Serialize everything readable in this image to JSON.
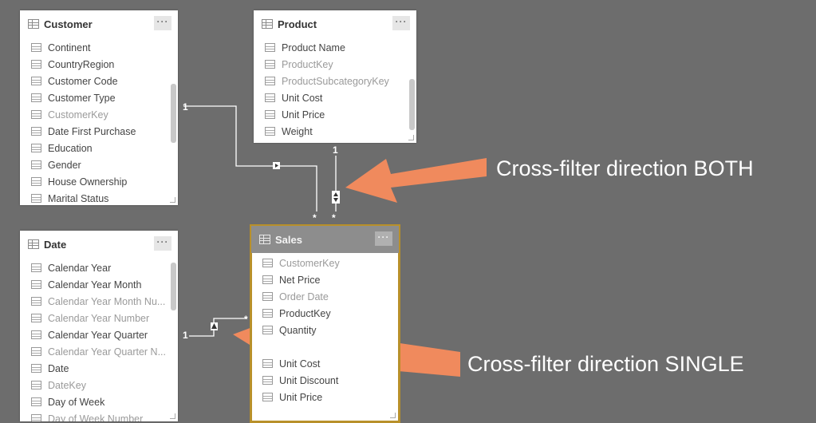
{
  "tables": {
    "customer": {
      "title": "Customer",
      "more": "···",
      "fields": [
        "Continent",
        "CountryRegion",
        "Customer Code",
        "Customer Type",
        "CustomerKey",
        "Date First Purchase",
        "Education",
        "Gender",
        "House Ownership",
        "Marital Status"
      ]
    },
    "product": {
      "title": "Product",
      "more": "···",
      "fields": [
        "Product Name",
        "ProductKey",
        "ProductSubcategoryKey",
        "Unit Cost",
        "Unit Price",
        "Weight"
      ]
    },
    "date": {
      "title": "Date",
      "more": "···",
      "fields": [
        "Calendar Year",
        "Calendar Year Month",
        "Calendar Year Month Nu...",
        "Calendar Year Number",
        "Calendar Year Quarter",
        "Calendar Year Quarter N...",
        "Date",
        "DateKey",
        "Day of Week",
        "Day of Week Number"
      ]
    },
    "sales": {
      "title": "Sales",
      "more": "···",
      "fields": [
        "CustomerKey",
        "Net Price",
        "Order Date",
        "ProductKey",
        "Quantity",
        "",
        "Unit Cost",
        "Unit Discount",
        "Unit Price"
      ]
    }
  },
  "relationships": {
    "customer_one": "1",
    "product_one": "1",
    "date_one": "1",
    "sales_many_a": "*",
    "sales_many_b": "*",
    "date_many": "*"
  },
  "callouts": {
    "both": "Cross-filter direction BOTH",
    "single": "Cross-filter direction SINGLE"
  },
  "colors": {
    "background": "#6d6d6d",
    "arrow": "#f08a5d",
    "selected_outline": "#b8902a"
  }
}
